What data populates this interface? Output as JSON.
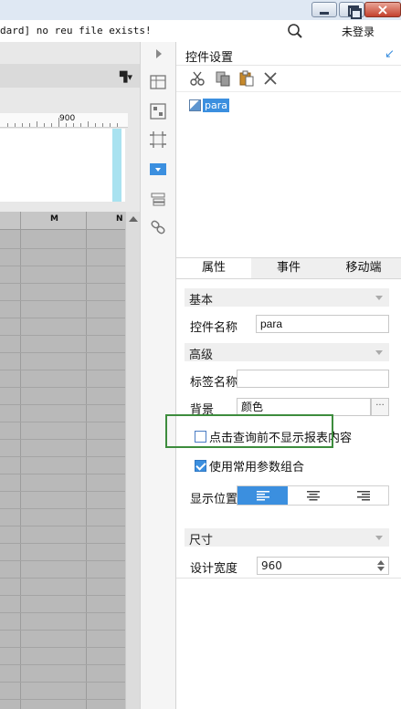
{
  "topbar": {
    "status_text": "dard] no reu file exists!",
    "login_label": "未登录",
    "icons": [
      "minimize-icon",
      "restore-icon",
      "close-icon",
      "search-icon"
    ]
  },
  "editor": {
    "ruler_label": "900",
    "column_headers": [
      "M",
      "N"
    ]
  },
  "panel": {
    "title": "控件设置",
    "toolbar_icons": [
      "cut-icon",
      "copy-icon",
      "paste-icon",
      "delete-icon"
    ],
    "tree_node_label": "para",
    "tabs": [
      "属性",
      "事件",
      "移动端"
    ],
    "active_tab": "属性",
    "sections": {
      "basic": "基本",
      "advanced": "高级",
      "size": "尺寸"
    },
    "fields": {
      "widget_name_label": "控件名称",
      "widget_name_value": "para",
      "tag_name_label": "标签名称",
      "tag_name_value": "",
      "background_label": "背景",
      "background_value": "颜色",
      "more_label": "···"
    },
    "checks": {
      "hide_before_query": "点击查询前不显示报表内容",
      "hide_before_query_checked": false,
      "use_common_params": "使用常用参数组合",
      "use_common_params_checked": true
    },
    "display_position": {
      "label": "显示位置",
      "options": [
        "left-align",
        "center-align",
        "right-align"
      ],
      "selected": "left-align"
    },
    "design_width": {
      "label": "设计宽度",
      "value": "960"
    }
  },
  "colors": {
    "accent": "#3b8fdf",
    "highlight_border": "#3d8c3d",
    "cyan_strip": "#a9e2f0"
  }
}
